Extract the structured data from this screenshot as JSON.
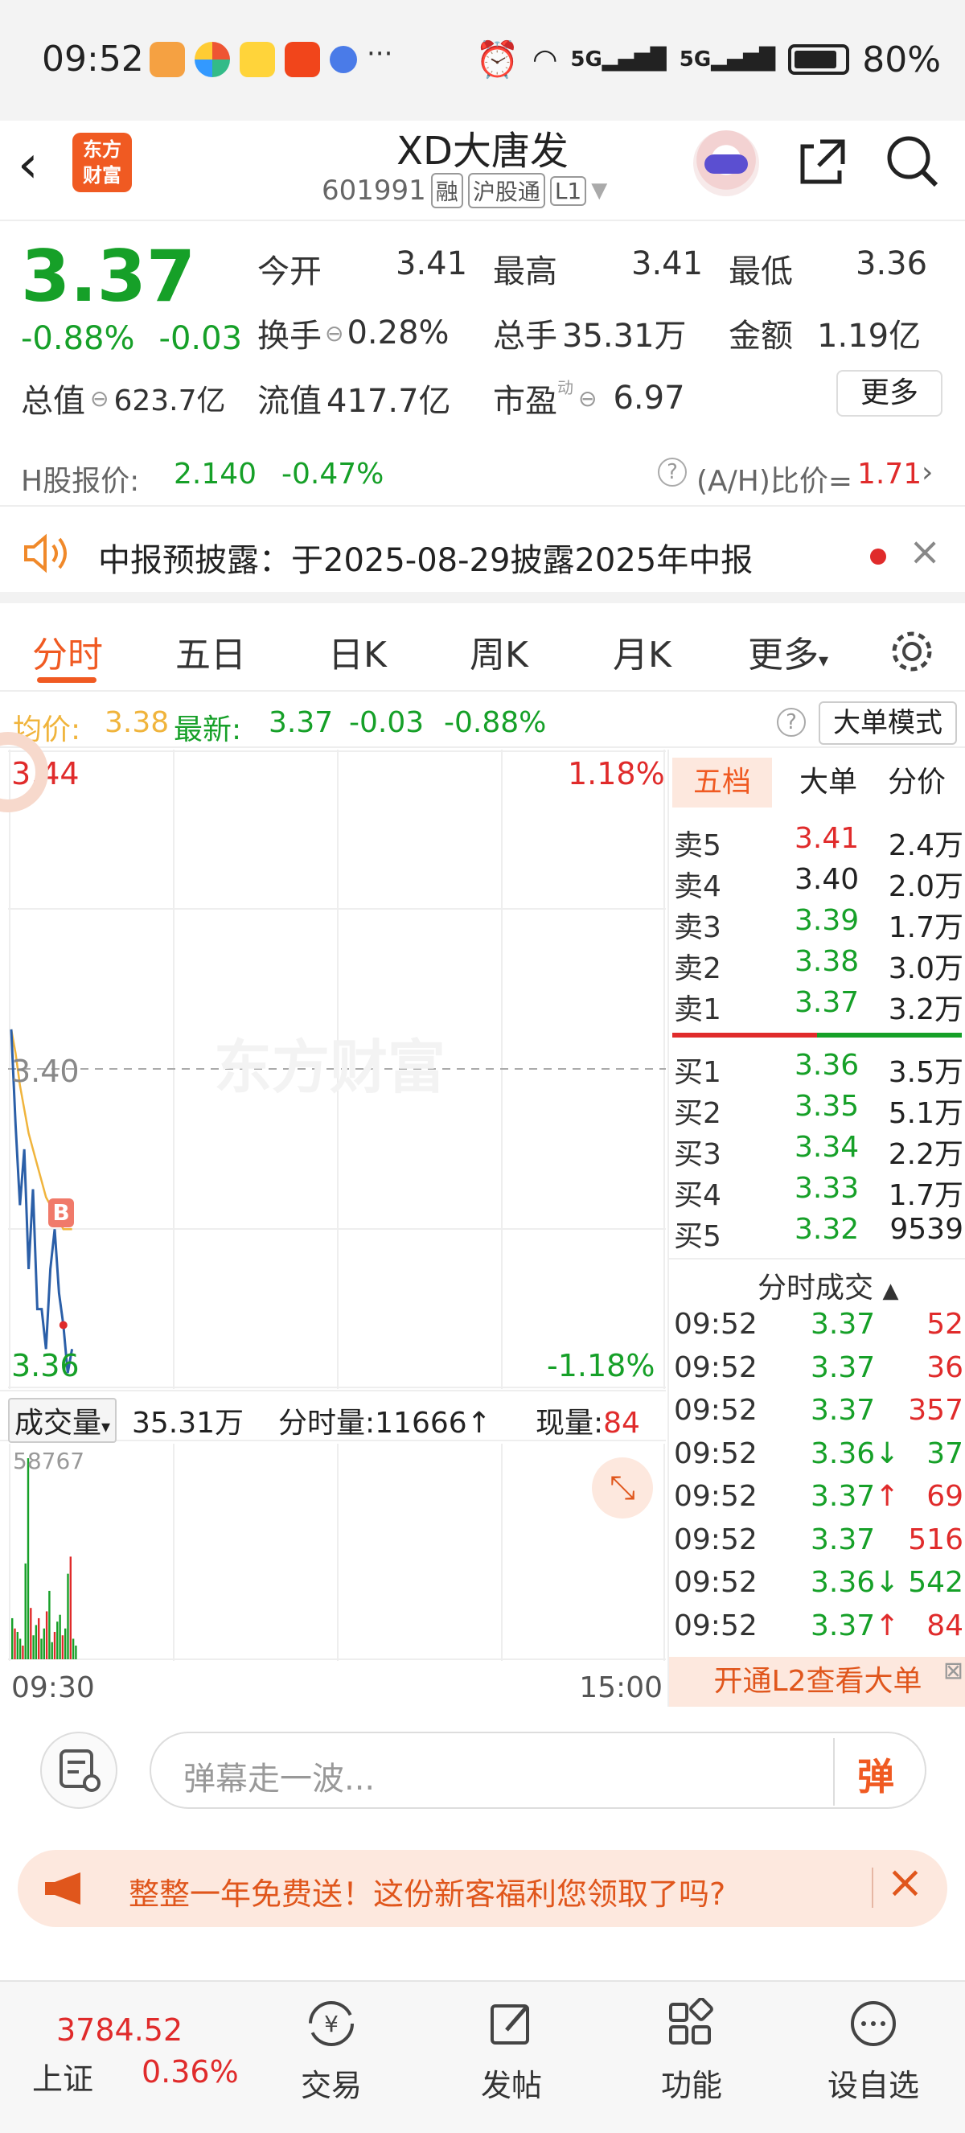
{
  "status_bar": {
    "time": "09:52",
    "battery": "80%",
    "signal_1": "5G",
    "signal_2": "5G"
  },
  "header": {
    "logo_text_1": "东方",
    "logo_text_2": "财富",
    "title": "XD大唐发",
    "code": "601991",
    "tags": [
      "融",
      "沪股通",
      "L1"
    ]
  },
  "quote": {
    "price": "3.37",
    "change_pct": "-0.88%",
    "change": "-0.03",
    "today_open_label": "今开",
    "today_open": "3.41",
    "high_label": "最高",
    "high": "3.41",
    "low_label": "最低",
    "low": "3.36",
    "turnover_rate_label": "换手",
    "turnover_rate": "0.28%",
    "total_hands_label": "总手",
    "total_hands": "35.31万",
    "amount_label": "金额",
    "amount": "1.19亿",
    "total_value_label": "总值",
    "total_value": "623.7亿",
    "float_value_label": "流值",
    "float_value": "417.7亿",
    "pe_label": "市盈",
    "pe_sup": "动",
    "pe": "6.97",
    "more_label": "更多"
  },
  "h_share": {
    "label": "H股报价:",
    "price": "2.140",
    "change_pct": "-0.47%",
    "ratio_label": "(A/H)比价=",
    "ratio": "1.71"
  },
  "notice": {
    "text": "中报预披露：于2025-08-29披露2025年中报"
  },
  "tabs": [
    "分时",
    "五日",
    "日K",
    "周K",
    "月K",
    "更多"
  ],
  "avg_row": {
    "avg_label": "均价:",
    "avg": "3.38",
    "latest_label": "最新:",
    "latest": "3.37",
    "chg": "-0.03",
    "chg_pct": "-0.88%",
    "mode_btn": "大单模式"
  },
  "chart": {
    "top_price": "3.44",
    "top_pct": "1.18%",
    "mid_price": "3.40",
    "bottom_price": "3.36",
    "bottom_pct": "-1.18%",
    "watermark": "东方财富",
    "marker": "B",
    "colors": {
      "price_line": "#2b5fa8",
      "avg_line": "#f0b43c",
      "up": "#e02b2b",
      "down": "#16a028"
    }
  },
  "chart_data": {
    "type": "line",
    "title": "",
    "x_range": [
      "09:30",
      "15:00"
    ],
    "ylim": [
      3.36,
      3.44
    ],
    "series": [
      {
        "values": [
          3.405,
          3.393,
          3.383,
          3.39,
          3.375,
          3.385,
          3.37,
          3.37,
          3.365,
          3.375,
          3.38,
          3.372,
          3.368,
          3.362,
          3.365
        ]
      },
      {
        "values": [
          3.405,
          3.402,
          3.398,
          3.395,
          3.392,
          3.39,
          3.388,
          3.386,
          3.384,
          3.383,
          3.382,
          3.381,
          3.38,
          3.38,
          3.38
        ]
      }
    ]
  },
  "volume": {
    "label": "成交量",
    "total": "35.31万",
    "fenshi_label": "分时量:",
    "fenshi": "11666",
    "current_label": "现量:",
    "current": "84",
    "max": "58767",
    "time_start": "09:30",
    "time_end": "15:00"
  },
  "volume_chart_data": {
    "type": "bar",
    "values": [
      12000,
      9000,
      8000,
      6000,
      4000,
      28000,
      58767,
      15000,
      7000,
      10000,
      12000,
      6000,
      9000,
      14000,
      20000,
      5000,
      8000,
      11000,
      13000,
      7000,
      9000,
      25000,
      30000,
      6000,
      4000
    ]
  },
  "orderbook": {
    "tabs": [
      "五档",
      "大单",
      "分价"
    ],
    "sells": [
      {
        "label": "卖5",
        "price": "3.41",
        "vol": "2.4万",
        "color": "red"
      },
      {
        "label": "卖4",
        "price": "3.40",
        "vol": "2.0万",
        "color": "dark"
      },
      {
        "label": "卖3",
        "price": "3.39",
        "vol": "1.7万",
        "color": "green"
      },
      {
        "label": "卖2",
        "price": "3.38",
        "vol": "3.0万",
        "color": "green"
      },
      {
        "label": "卖1",
        "price": "3.37",
        "vol": "3.2万",
        "color": "green"
      }
    ],
    "buys": [
      {
        "label": "买1",
        "price": "3.36",
        "vol": "3.5万",
        "color": "green"
      },
      {
        "label": "买2",
        "price": "3.35",
        "vol": "5.1万",
        "color": "green"
      },
      {
        "label": "买3",
        "price": "3.34",
        "vol": "2.2万",
        "color": "green"
      },
      {
        "label": "买4",
        "price": "3.33",
        "vol": "1.7万",
        "color": "green"
      },
      {
        "label": "买5",
        "price": "3.32",
        "vol": "9539",
        "color": "green"
      }
    ],
    "trades_title": "分时成交",
    "trades": [
      {
        "t": "09:52",
        "p": "3.37",
        "arrow": "",
        "v": "52",
        "vc": "red"
      },
      {
        "t": "09:52",
        "p": "3.37",
        "arrow": "",
        "v": "36",
        "vc": "red"
      },
      {
        "t": "09:52",
        "p": "3.37",
        "arrow": "",
        "v": "357",
        "vc": "red"
      },
      {
        "t": "09:52",
        "p": "3.36",
        "arrow": "↓",
        "v": "37",
        "vc": "green"
      },
      {
        "t": "09:52",
        "p": "3.37",
        "arrow": "↑",
        "v": "69",
        "vc": "red"
      },
      {
        "t": "09:52",
        "p": "3.37",
        "arrow": "",
        "v": "516",
        "vc": "red"
      },
      {
        "t": "09:52",
        "p": "3.36",
        "arrow": "↓",
        "v": "542",
        "vc": "green"
      },
      {
        "t": "09:52",
        "p": "3.37",
        "arrow": "↑",
        "v": "84",
        "vc": "red"
      }
    ],
    "l2_text": "开通L2查看大单"
  },
  "comment": {
    "placeholder": "弹幕走一波...",
    "send": "弹"
  },
  "promo": {
    "text": "整整一年免费送！这份新客福利您领取了吗?"
  },
  "bottom_nav": {
    "index_value": "3784.52",
    "index_name": "上证",
    "index_pct": "0.36%",
    "items": [
      "交易",
      "发帖",
      "功能",
      "设自选"
    ]
  }
}
